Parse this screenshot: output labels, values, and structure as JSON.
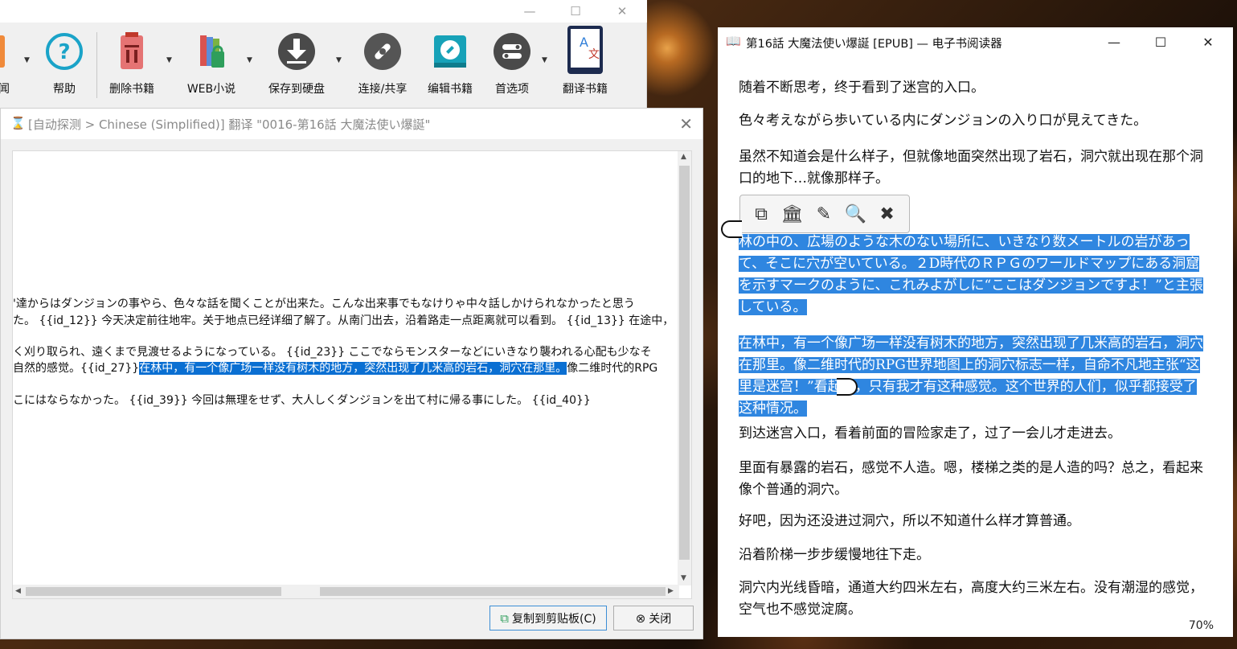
{
  "calibre": {
    "toolbar": [
      {
        "label": "新闻",
        "icon": "news-icon"
      },
      {
        "label": "帮助",
        "icon": "help-icon"
      },
      {
        "label": "删除书籍",
        "icon": "delete-icon"
      },
      {
        "label": "WEB小说",
        "icon": "web-novel-icon"
      },
      {
        "label": "保存到硬盘",
        "icon": "save-to-disk-icon"
      },
      {
        "label": "连接/共享",
        "icon": "connect-share-icon"
      },
      {
        "label": "编辑书籍",
        "icon": "edit-book-icon"
      },
      {
        "label": "首选项",
        "icon": "preferences-icon"
      },
      {
        "label": "翻译书籍",
        "icon": "translate-book-icon"
      }
    ]
  },
  "translate_dialog": {
    "title": "[自动探测 > Chinese (Simplified)] 翻译 \"0016-第16話 大魔法使い爆誕\"",
    "lines": [
      "'達からはダンジョンの事やら、色々な話を聞くことが出来た。こんな出来事でもなけりゃ中々話しかけられなかったと思う",
      "た。 {{id_12}} 今天决定前往地牢。关于地点已经详细了解了。从南门出去，沿着路走一点距离就可以看到。 {{id_13}} 在途中，",
      "く刈り取られ、遠くまで見渡せるようになっている。 {{id_23}} ここでならモンスターなどにいきなり襲われる心配も少なそ",
      "自然的感觉。{{id_27}}",
      "在林中，有一个像广场一样没有树木的地方，突然出现了几米高的岩石，洞穴在那里。",
      "像二维时代的RPG",
      "こにはならなかった。 {{id_39}} 今回は無理をせず、大人しくダンジョンを出て村に帰る事にした。 {{id_40}}"
    ],
    "copy_button": "复制到剪贴板(C)",
    "close_button": "关闭"
  },
  "viewer": {
    "title": "第16話 大魔法使い爆誕 [EPUB] — 电子书阅读器",
    "paragraphs": [
      "随着不断思考，终于看到了迷宫的入口。",
      "色々考えながら歩いている内にダンジョンの入り口が見えてきた。",
      "虽然不知道会是什么样子，但就像地面突然出现了岩石，洞穴就出现在那个洞口的地下…就像那样子。",
      "林の中の、広場のような木のない場所に、いきなり数メートルの岩があって、そこに穴が空いている。２D時代のＲＰＧのワールドマップにある洞窟を示すマークのように、これみよがしに“ここはダンジョンですよ！”と主張している。",
      "在林中，有一个像广场一样没有树木的地方，突然出现了几米高的岩石，洞穴在那里。像二维时代的RPG世界地图上的洞穴标志一样，自命不凡地主张“这里是迷宫！”看起来，只有我才有这种感觉。这个世界的人们，似乎都接受了这种情况。",
      "到达迷宫入口，看着前面的冒险家走了，过了一会儿才走进去。",
      "里面有暴露的岩石，感觉不人造。嗯，楼梯之类的是人造的吗？总之，看起来像个普通的洞穴。",
      "好吧，因为还没进过洞穴，所以不知道什么样才算普通。",
      "沿着阶梯一步步缓慢地往下走。",
      "洞穴内光线昏暗，通道大约四米左右，高度大约三米左右。没有潮湿的感觉，空气也不感觉淀腐。"
    ],
    "zoom": "70%",
    "popup_icons": [
      "copy-icon",
      "lookup-icon",
      "highlight-icon",
      "search-icon",
      "close-icon"
    ]
  },
  "colors": {
    "selection": "#0a6fd2",
    "viewer_highlight": "#2f86e0"
  }
}
